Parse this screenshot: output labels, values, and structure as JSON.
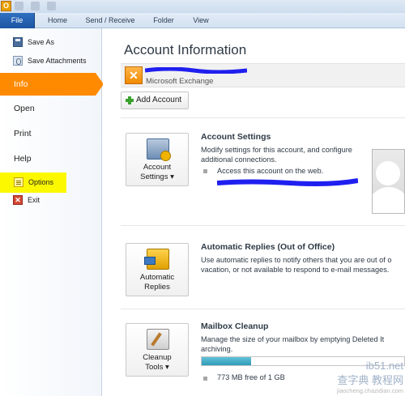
{
  "app_icon_letter": "O",
  "tabs": {
    "file": "File",
    "home": "Home",
    "send_receive": "Send / Receive",
    "folder": "Folder",
    "view": "View"
  },
  "backstage": {
    "save_as": "Save As",
    "save_attachments": "Save Attachments",
    "info": "Info",
    "open": "Open",
    "print": "Print",
    "help": "Help",
    "options": "Options",
    "exit": "Exit"
  },
  "main": {
    "title": "Account Information",
    "account_type": "Microsoft Exchange",
    "add_account": "Add Account",
    "account_settings": {
      "button_line1": "Account",
      "button_line2": "Settings ▾",
      "title": "Account Settings",
      "desc_line1": "Modify settings for this account, and configure",
      "desc_line2": "additional connections.",
      "bullet": "Access this account on the web."
    },
    "automatic_replies": {
      "button_line1": "Automatic",
      "button_line2": "Replies",
      "title": "Automatic Replies (Out of Office)",
      "desc_line1": "Use automatic replies to notify others that you are out of o",
      "desc_line2": "vacation, or not available to respond to e-mail messages."
    },
    "mailbox_cleanup": {
      "button_line1": "Cleanup",
      "button_line2": "Tools ▾",
      "title": "Mailbox Cleanup",
      "desc_line1": "Manage the size of your mailbox by emptying Deleted It",
      "desc_line2": "archiving.",
      "free_text": "773 MB free of 1 GB",
      "used_fraction": 0.245
    }
  },
  "watermark": {
    "line1": "查字典 教程网",
    "line2": "jiaocheng.chazidian.com",
    "ib51": "ib51.net"
  },
  "colors": {
    "file_tab": "#1d55a3",
    "info_selected": "#ff8a00",
    "options_highlight": "#fcf800",
    "redaction": "#1f1ff0",
    "progress": "#2f9bb8"
  }
}
